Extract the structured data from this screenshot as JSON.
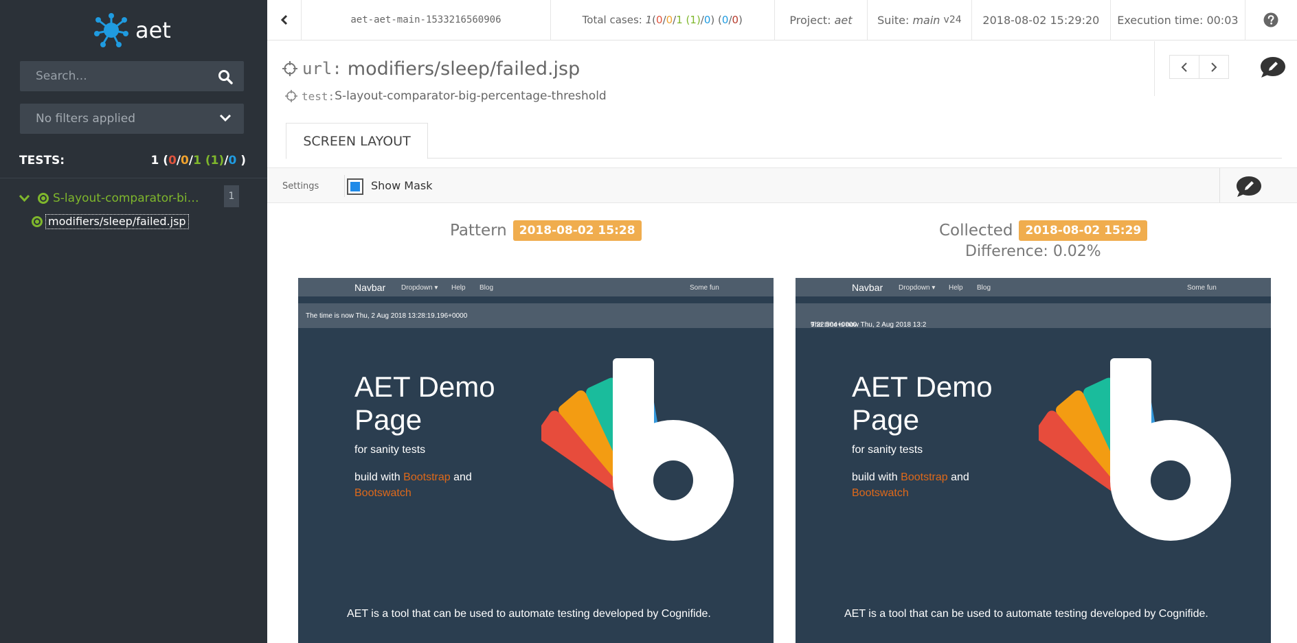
{
  "app": {
    "name": "aet"
  },
  "sidebar": {
    "search_placeholder": "Search...",
    "filters_label": "No filters applied",
    "tests_label": "TESTS:",
    "counts": {
      "total": "1",
      "open": " (",
      "failed": "0",
      "s1": "/",
      "warning": "0",
      "s2": "/",
      "passed": "1 (1)",
      "s3": "/",
      "rebased": "0",
      "close": " )"
    },
    "suite_name": "S-layout-comparator-big-percentage-threshold",
    "suite_badge": "1",
    "test_name": "modifiers/sleep/failed.jsp"
  },
  "topbar": {
    "report_id": "aet-aet-main-1533216560906",
    "total_label": "Total cases:",
    "total_value": "1",
    "c_open": " ( ",
    "c_failed": "0",
    "c_s1": " / ",
    "c_warning": "0",
    "c_s2": " / ",
    "c_passed": "1 (1)",
    "c_s3": " / ",
    "c_rebased": "0",
    "c_mid": " ) ( ",
    "c_acc": "0",
    "c_s4": " / ",
    "c_rej": "0",
    "c_close": " )",
    "project_label": "Project:",
    "project_value": "aet",
    "suite_label": "Suite:",
    "suite_value": "main",
    "suite_version": "v24",
    "datetime": "2018-08-02 15:29:20",
    "execution_time": "Execution time: 00:03",
    "help_icon": "question-circle-icon"
  },
  "header": {
    "url_key": "url:",
    "url_value": "modifiers/sleep/failed.jsp",
    "test_key": "test:",
    "test_value": "S-layout-comparator-big-percentage-threshold"
  },
  "tabs": [
    {
      "label": "SCREEN LAYOUT"
    }
  ],
  "settings": {
    "label": "Settings",
    "show_mask_label": "Show Mask",
    "show_mask_checked": true
  },
  "comparison": {
    "pattern_label": "Pattern",
    "pattern_date": "2018-08-02 15:28",
    "collected_label": "Collected",
    "collected_date": "2018-08-02 15:29",
    "difference": "Difference: 0.02%"
  },
  "screenshot": {
    "brand": "Navbar",
    "nav_dropdown": "Dropdown ▾",
    "nav_help": "Help",
    "nav_blog": "Blog",
    "nav_right": "Some fun",
    "pattern_time": "The time is now Thu, 2 Aug 2018 13:28:19.196+0000",
    "collected_time_prefix": "The time is now Thu, 2 Aug 2018 13:2",
    "collected_time_diff": "9:22.504+0000",
    "heading": "AET Demo Page",
    "subheading": "for sanity tests",
    "build_prefix": "build with",
    "bootstrap": "Bootstrap",
    "and": "and",
    "bootswatch": "Bootswatch",
    "description": "AET is a tool that can be used to automate testing developed by Cognifide."
  },
  "colors": {
    "sidebar_bg": "#2b3138",
    "accent_green": "#7fb72c",
    "badge_orange": "#f0ad4e",
    "failed_red": "#e0533d",
    "rebased_blue": "#1f9be0",
    "demo_bg": "#2b3e50",
    "demo_orange": "#df691a"
  }
}
